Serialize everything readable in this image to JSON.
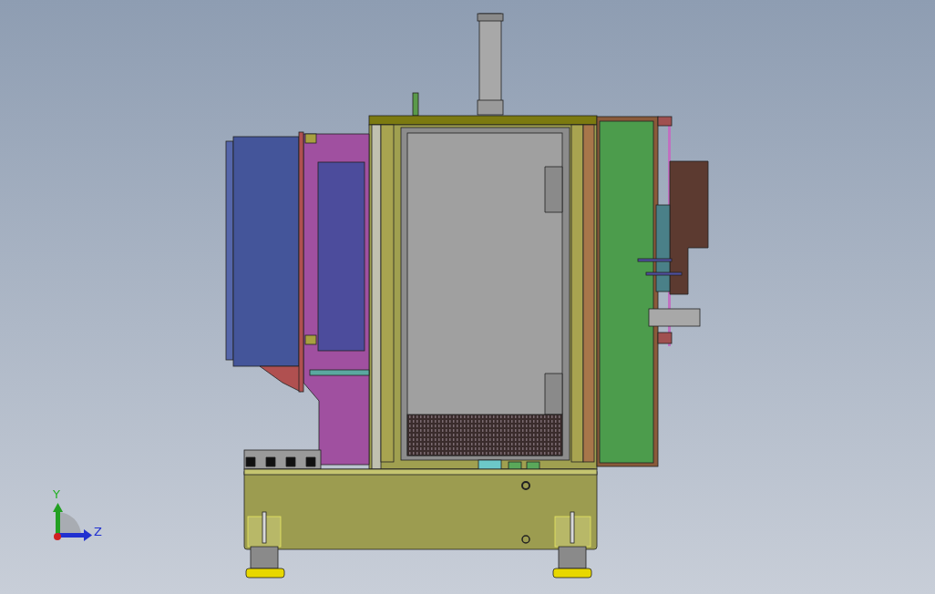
{
  "viewport": {
    "triad_axes": [
      {
        "label": "Y"
      },
      {
        "label": "Z"
      }
    ]
  }
}
